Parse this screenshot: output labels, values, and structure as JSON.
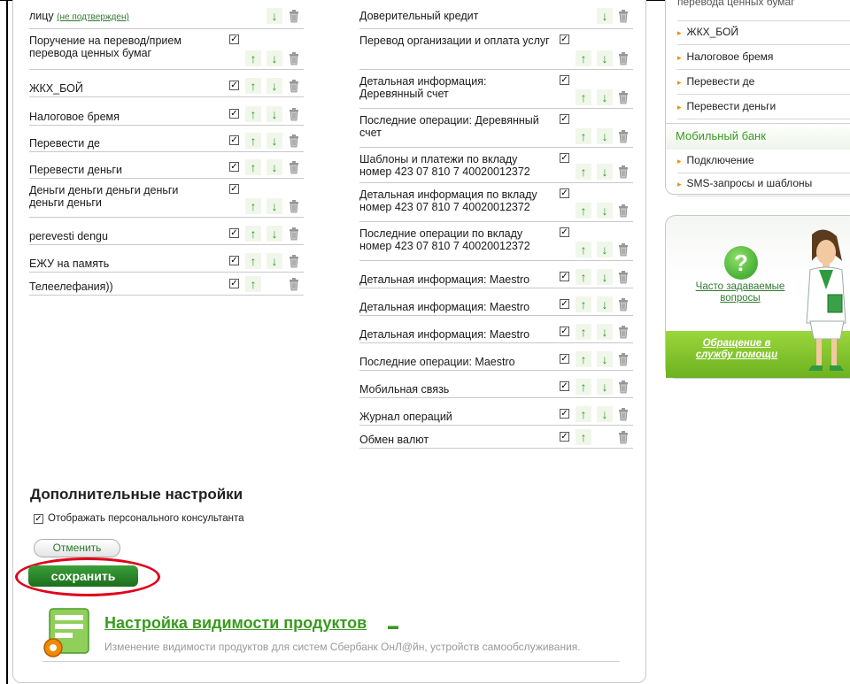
{
  "left_list": [
    {
      "label": "лицу",
      "link": "(не подтвержден)",
      "checked": null,
      "up": false,
      "down": true
    },
    {
      "label": "Поручение на перевод/прием перевода ценных бумаг",
      "checked": true,
      "up": true,
      "down": true
    },
    {
      "label": "ЖКХ_БОЙ",
      "checked": true,
      "up": true,
      "down": true
    },
    {
      "label": "Налоговое бремя",
      "checked": true,
      "up": true,
      "down": true
    },
    {
      "label": "Перевести де",
      "checked": true,
      "up": true,
      "down": true
    },
    {
      "label": "Перевести деньги",
      "checked": true,
      "up": true,
      "down": true
    },
    {
      "label": "Деньги деньги деньги деньги деньги деньги",
      "checked": true,
      "up": true,
      "down": true
    },
    {
      "label": "perevesti dengu",
      "checked": true,
      "up": true,
      "down": true
    },
    {
      "label": "ЕЖУ на память",
      "checked": true,
      "up": true,
      "down": true
    },
    {
      "label": "Телеелефания))",
      "checked": true,
      "up": true,
      "down": false
    }
  ],
  "right_list": [
    {
      "label": "Доверительный кредит",
      "checked": null,
      "up": false,
      "down": true
    },
    {
      "label": "Перевод организации и оплата услуг",
      "checked": true,
      "up": true,
      "down": true
    },
    {
      "label": "Детальная информация: Деревянный счет",
      "checked": true,
      "up": true,
      "down": true
    },
    {
      "label": "Последние операции: Деревянный счет",
      "checked": true,
      "up": true,
      "down": true
    },
    {
      "label": "Шаблоны и платежи по вкладу номер 423 07 810 7 40020012372",
      "checked": true,
      "up": true,
      "down": true
    },
    {
      "label": "Детальная информация по вкладу номер 423 07 810 7 40020012372",
      "checked": true,
      "up": true,
      "down": true
    },
    {
      "label": "Последние операции по вкладу номер 423 07 810 7 40020012372",
      "checked": true,
      "up": true,
      "down": true
    },
    {
      "label": "Детальная информация: Maestro",
      "checked": true,
      "up": true,
      "down": true
    },
    {
      "label": "Детальная информация: Maestro",
      "checked": true,
      "up": true,
      "down": true
    },
    {
      "label": "Детальная информация: Maestro",
      "checked": true,
      "up": true,
      "down": true
    },
    {
      "label": "Последние операции: Maestro",
      "checked": true,
      "up": true,
      "down": true
    },
    {
      "label": "Мобильная связь",
      "checked": true,
      "up": true,
      "down": true
    },
    {
      "label": "Журнал операций",
      "checked": true,
      "up": true,
      "down": true
    },
    {
      "label": "Обмен валют",
      "checked": true,
      "up": true,
      "down": false
    }
  ],
  "additional": {
    "title": "Дополнительные настройки",
    "consultant_label": "Отображать персонального консультанта",
    "consultant_checked": true,
    "cancel_label": "Отменить",
    "save_label": "сохранить"
  },
  "visibility": {
    "title": "Настройка видимости продуктов",
    "description": "Изменение видимости продуктов для систем Сбербанк ОнЛ@йн, устройств самообслуживания."
  },
  "sidebar": {
    "partial_item": "перевода ценных бумаг",
    "items": [
      "ЖКХ_БОЙ",
      "Налоговое бремя",
      "Перевести де",
      "Перевести деньги"
    ],
    "mobile_title": "Мобильный банк",
    "mobile_items": [
      "Подключение",
      "SMS-запросы и шаблоны"
    ]
  },
  "help": {
    "faq_label": "Часто задаваемые вопросы",
    "support_label": "Обращение в службу помощи"
  },
  "colors": {
    "accent_green": "#3a9a1f",
    "arrow_green": "#2f9a2f",
    "highlight_red": "#e0001b",
    "bullet_orange": "#f08a00"
  },
  "icons": {
    "up": "arrow-up-icon",
    "down": "arrow-down-icon",
    "delete": "trash-icon",
    "faq": "question-icon"
  }
}
